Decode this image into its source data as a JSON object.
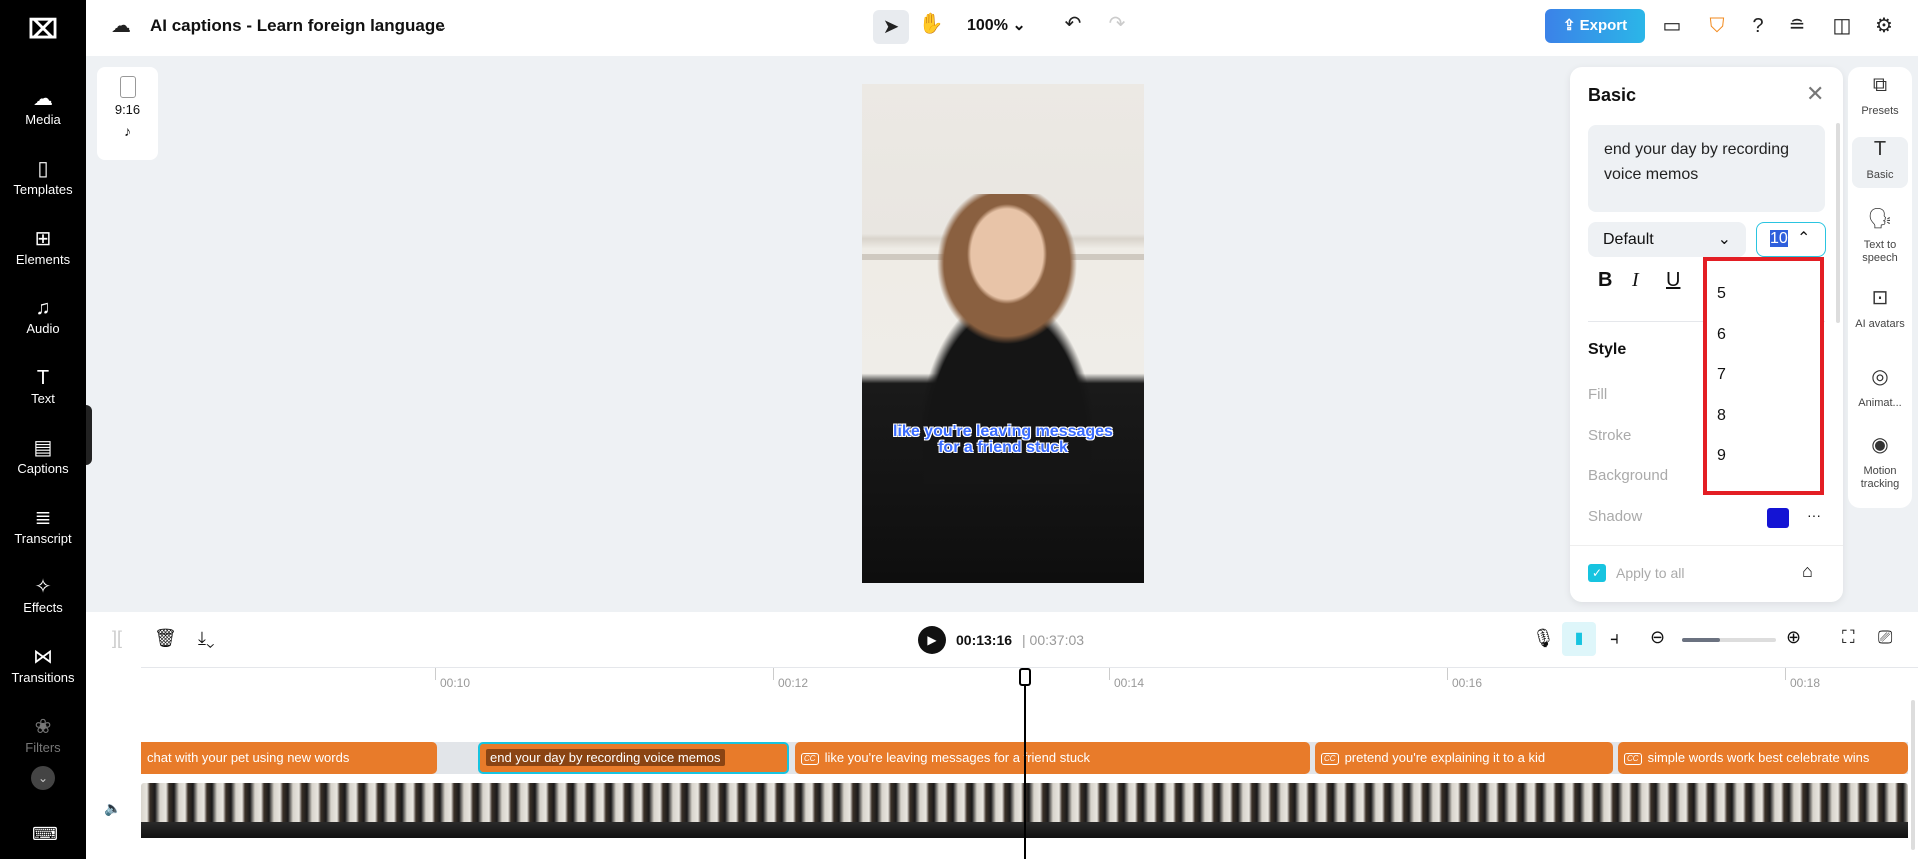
{
  "sidebar": {
    "items": [
      {
        "label": "Media",
        "icon": "cloud-upload-icon"
      },
      {
        "label": "Templates",
        "icon": "templates-icon"
      },
      {
        "label": "Elements",
        "icon": "elements-icon"
      },
      {
        "label": "Audio",
        "icon": "music-note-icon"
      },
      {
        "label": "Text",
        "icon": "text-icon"
      },
      {
        "label": "Captions",
        "icon": "captions-icon"
      },
      {
        "label": "Transcript",
        "icon": "transcript-icon"
      },
      {
        "label": "Effects",
        "icon": "effects-icon"
      },
      {
        "label": "Transitions",
        "icon": "transitions-icon"
      },
      {
        "label": "Filters",
        "icon": "filters-icon"
      }
    ]
  },
  "header": {
    "title": "AI captions - Learn foreign language",
    "zoom": "100%",
    "export_label": "Export"
  },
  "canvas": {
    "ratio": "9:16",
    "caption_line1": "like you're leaving messages",
    "caption_line2": "for a friend stuck"
  },
  "panel": {
    "title": "Basic",
    "text": "end your day by recording voice memos",
    "font": "Default",
    "font_size": "10",
    "style_heading": "Style",
    "fill": "Fill",
    "stroke": "Stroke",
    "background": "Background",
    "shadow": "Shadow",
    "shadow_color": "#1414d4",
    "apply_all": "Apply to all"
  },
  "font_size_options": [
    "5",
    "6",
    "7",
    "8",
    "9"
  ],
  "right_tabs": [
    {
      "label": "Presets"
    },
    {
      "label": "Basic"
    },
    {
      "label": "Text to speech"
    },
    {
      "label": "AI avatars"
    },
    {
      "label": "Animat..."
    },
    {
      "label": "Motion tracking"
    }
  ],
  "timeline": {
    "current": "00:13:16",
    "total": "00:37:03",
    "ticks": [
      "00:10",
      "00:12",
      "00:14",
      "00:16",
      "00:18"
    ],
    "clips": [
      "chat with your pet using new words",
      "end your day by recording voice memos",
      "like you're leaving messages for a friend stuck",
      "pretend you're explaining it to a kid",
      "simple words work best celebrate wins"
    ]
  },
  "colors": {
    "accent": "#17c4e0",
    "clip": "#e87b2a",
    "highlight": "#e31e24"
  }
}
